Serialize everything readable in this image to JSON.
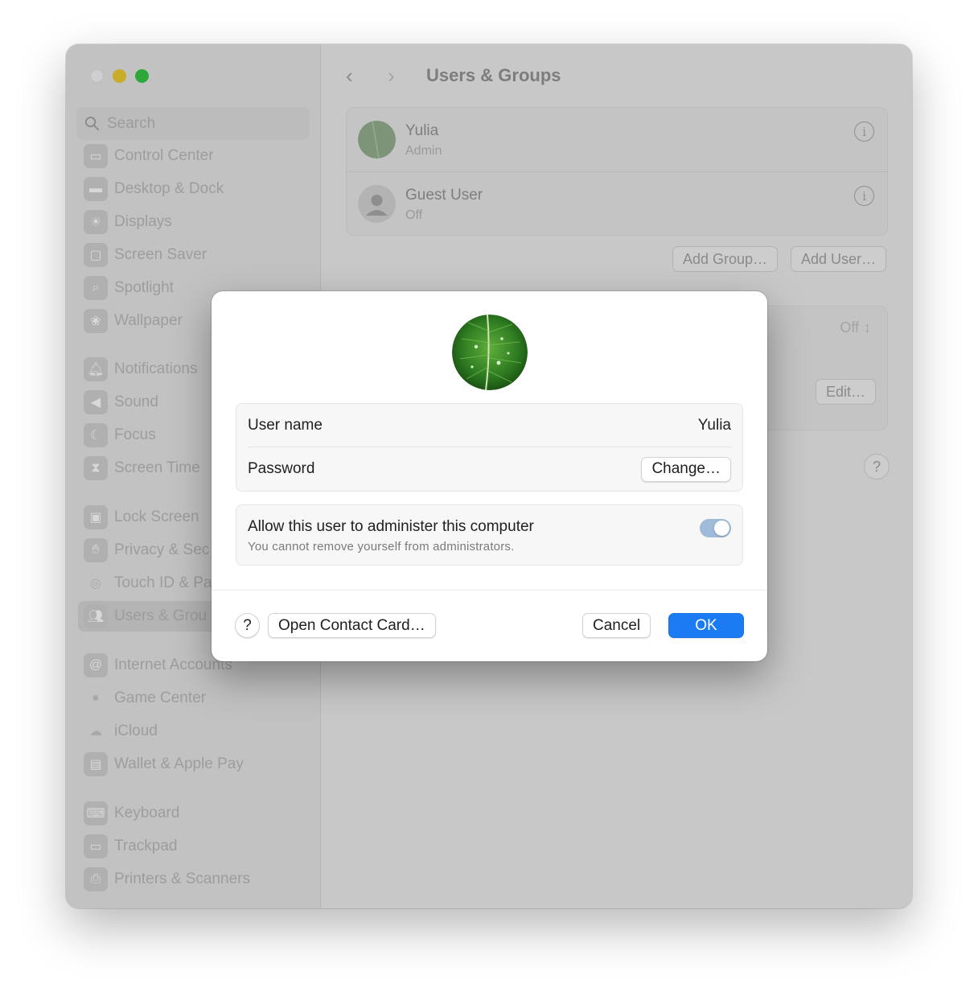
{
  "sidebar": {
    "search_placeholder": "Search",
    "items": [
      {
        "label": "Control Center",
        "icon": "control-center-icon"
      },
      {
        "label": "Desktop & Dock",
        "icon": "desktop-dock-icon"
      },
      {
        "label": "Displays",
        "icon": "displays-icon"
      },
      {
        "label": "Screen Saver",
        "icon": "screen-saver-icon"
      },
      {
        "label": "Spotlight",
        "icon": "spotlight-icon"
      },
      {
        "label": "Wallpaper",
        "icon": "wallpaper-icon"
      },
      {
        "label": "Notifications",
        "icon": "notifications-icon"
      },
      {
        "label": "Sound",
        "icon": "sound-icon"
      },
      {
        "label": "Focus",
        "icon": "focus-icon"
      },
      {
        "label": "Screen Time",
        "icon": "screen-time-icon"
      },
      {
        "label": "Lock Screen",
        "icon": "lock-icon"
      },
      {
        "label": "Privacy & Sec",
        "icon": "hand-icon"
      },
      {
        "label": "Touch ID & Pa",
        "icon": "fingerprint-icon"
      },
      {
        "label": "Users & Grou",
        "icon": "users-icon"
      },
      {
        "label": "Internet Accounts",
        "icon": "at-icon"
      },
      {
        "label": "Game Center",
        "icon": "game-center-icon"
      },
      {
        "label": "iCloud",
        "icon": "cloud-icon"
      },
      {
        "label": "Wallet & Apple Pay",
        "icon": "wallet-icon"
      },
      {
        "label": "Keyboard",
        "icon": "keyboard-icon"
      },
      {
        "label": "Trackpad",
        "icon": "trackpad-icon"
      },
      {
        "label": "Printers & Scanners",
        "icon": "printer-icon"
      }
    ]
  },
  "main": {
    "title": "Users & Groups",
    "users": [
      {
        "name": "Yulia",
        "role": "Admin"
      },
      {
        "name": "Guest User",
        "role": "Off"
      }
    ],
    "add_group": "Add Group…",
    "add_user": "Add User…",
    "off_value": "Off",
    "edit": "Edit…",
    "help": "?"
  },
  "dialog": {
    "username_label": "User name",
    "username_value": "Yulia",
    "password_label": "Password",
    "change_button": "Change…",
    "admin_title": "Allow this user to administer this computer",
    "admin_subtitle": "You cannot remove yourself from administrators.",
    "admin_toggle_on": true,
    "help": "?",
    "open_contact": "Open Contact Card…",
    "cancel": "Cancel",
    "ok": "OK"
  },
  "colors": {
    "accent": "#1a7bf2",
    "toggle_disabled_on": "#9fbbd8",
    "traffic_min": "#c9ad2a",
    "traffic_max": "#2fa83a"
  }
}
